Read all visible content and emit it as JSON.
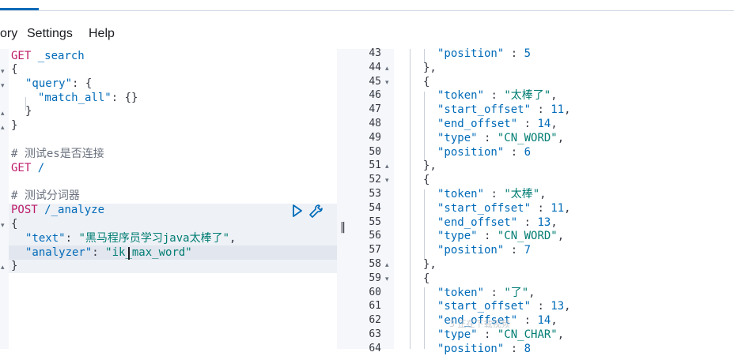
{
  "menu": {
    "history": "ory",
    "settings": "Settings",
    "help": "Help"
  },
  "request": {
    "l1_method": "GET",
    "l1_path": "_search",
    "l2": "{",
    "l3_key": "\"query\"",
    "l3_rest": ": {",
    "l4_key": "\"match_all\"",
    "l4_rest": ": {}",
    "l5": "}",
    "l6": "}",
    "l8": "# 测试es是否连接",
    "l9_method": "GET",
    "l9_path": "/",
    "l11": "# 测试分词器",
    "l12_method": "POST",
    "l12_path": "/_analyze",
    "l13": "{",
    "l14_key": "\"text\"",
    "l14_colon": ": ",
    "l14_val": "\"黑马程序员学习java太棒了\"",
    "l14_comma": ",",
    "l15_key": "\"analyzer\"",
    "l15_colon": ": ",
    "l15_val": "\"ik_max_word\"",
    "l16": "}"
  },
  "response": {
    "lines": [
      {
        "n": "43",
        "text": "\"position\" : 5"
      },
      {
        "n": "44",
        "text": "},"
      },
      {
        "n": "45",
        "text": "{"
      },
      {
        "n": "46",
        "text": "\"token\" : \"太棒了\","
      },
      {
        "n": "47",
        "text": "\"start_offset\" : 11,"
      },
      {
        "n": "48",
        "text": "\"end_offset\" : 14,"
      },
      {
        "n": "49",
        "text": "\"type\" : \"CN_WORD\","
      },
      {
        "n": "50",
        "text": "\"position\" : 6"
      },
      {
        "n": "51",
        "text": "},"
      },
      {
        "n": "52",
        "text": "{"
      },
      {
        "n": "53",
        "text": "\"token\" : \"太棒\","
      },
      {
        "n": "54",
        "text": "\"start_offset\" : 11,"
      },
      {
        "n": "55",
        "text": "\"end_offset\" : 13,"
      },
      {
        "n": "56",
        "text": "\"type\" : \"CN_WORD\","
      },
      {
        "n": "57",
        "text": "\"position\" : 7"
      },
      {
        "n": "58",
        "text": "},"
      },
      {
        "n": "59",
        "text": "{"
      },
      {
        "n": "60",
        "text": "\"token\" : \"了\","
      },
      {
        "n": "61",
        "text": "\"start_offset\" : 13,"
      },
      {
        "n": "62",
        "text": "\"end_offset\" : 14,"
      },
      {
        "n": "63",
        "text": "\"type\" : \"CN_CHAR\","
      },
      {
        "n": "64",
        "text": "\"position\" : 8"
      }
    ]
  },
  "watermark": "3 正在下载视频",
  "colors": {
    "method": "#bd1c6a",
    "key": "#006bb8",
    "string": "#017d73",
    "comment": "#69707d",
    "tab_accent": "#006bb8"
  },
  "icons": {
    "run": "play-icon",
    "settings": "wrench-icon"
  }
}
